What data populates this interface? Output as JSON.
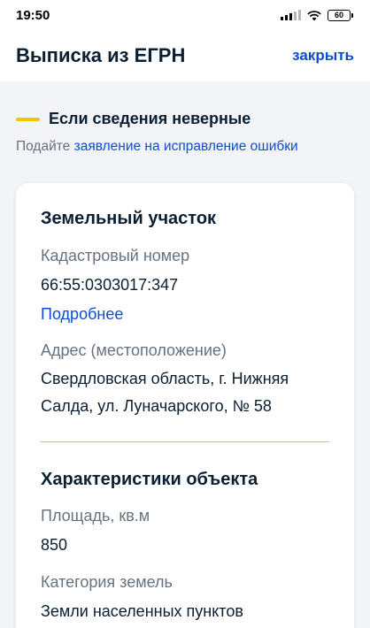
{
  "status_bar": {
    "time": "19:50",
    "battery": "60",
    "icons": [
      "signal-icon",
      "wifi-icon",
      "battery-icon"
    ]
  },
  "header": {
    "title": "Выписка из ЕГРН",
    "close_label": "закрыть"
  },
  "notice": {
    "title": "Если сведения неверные",
    "text_prefix": "Подайте ",
    "link_text": "заявление на исправление ошибки"
  },
  "land_plot": {
    "title": "Земельный участок",
    "cadastral_label": "Кадастровый номер",
    "cadastral_value": "66:55:0303017:347",
    "details_link": "Подробнее",
    "address_label": "Адрес (местоположение)",
    "address_line1": "Свердловская область, г. Нижняя",
    "address_line2": "Салда, ул. Луначарского, № 58"
  },
  "characteristics": {
    "title": "Характеристики объекта",
    "area_label": "Площадь, кв.м",
    "area_value": "850",
    "category_label": "Категория земель",
    "category_value": "Земли населенных пунктов"
  },
  "colors": {
    "accent": "#0d4cd3",
    "notice_bar": "#f5c200",
    "text": "#0b1f33",
    "secondary_text": "#66727f",
    "background": "#f2f4f7"
  }
}
